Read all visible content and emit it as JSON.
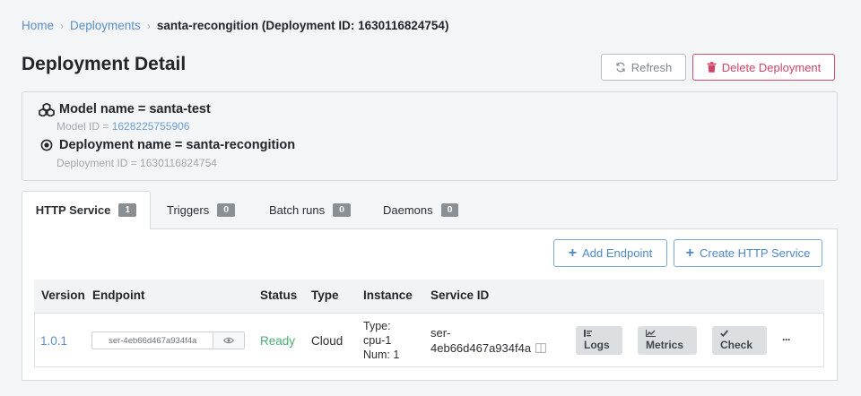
{
  "breadcrumb": {
    "home": "Home",
    "deployments": "Deployments",
    "current": "santa-recongition (Deployment ID: 1630116824754)"
  },
  "page_title": "Deployment Detail",
  "actions": {
    "refresh": "Refresh",
    "delete": "Delete Deployment"
  },
  "model": {
    "name_line": "Model name = santa-test",
    "id_label": "Model ID = ",
    "id_value": "1628225755906",
    "deployment_line": "Deployment name = santa-recongition",
    "deployment_id_line": "Deployment ID = 1630116824754"
  },
  "tabs": [
    {
      "label": "HTTP Service",
      "count": "1"
    },
    {
      "label": "Triggers",
      "count": "0"
    },
    {
      "label": "Batch runs",
      "count": "0"
    },
    {
      "label": "Daemons",
      "count": "0"
    }
  ],
  "panel_actions": {
    "add_endpoint": "Add Endpoint",
    "create_service": "Create HTTP Service"
  },
  "table": {
    "headers": [
      "Version",
      "Endpoint",
      "Status",
      "Type",
      "Instance",
      "Service ID"
    ],
    "row": {
      "version": "1.0.1",
      "endpoint": "ser-4eb66d467a934f4a",
      "status": "Ready",
      "type": "Cloud",
      "instance_type": "Type:",
      "instance_cpu": "cpu-1",
      "instance_num": "Num: 1",
      "service_id_prefix": "ser-",
      "service_id": "4eb66d467a934f4a",
      "logs": "Logs",
      "metrics": "Metrics",
      "check": "Check",
      "more": "···"
    }
  },
  "colors": {
    "link": "#5b8fc9",
    "danger": "#cf4565",
    "ready": "#4caf72",
    "badge": "#8a8f94"
  },
  "icons": {
    "refresh": "refresh-icon",
    "delete": "trash-icon",
    "model": "cubes-icon",
    "deployment": "target-icon",
    "plus": "plus-icon",
    "eye": "eye-icon",
    "copy": "copy-icon",
    "logs": "list-icon",
    "metrics": "chart-icon",
    "check": "checkmark-icon",
    "more": "ellipsis-icon"
  }
}
